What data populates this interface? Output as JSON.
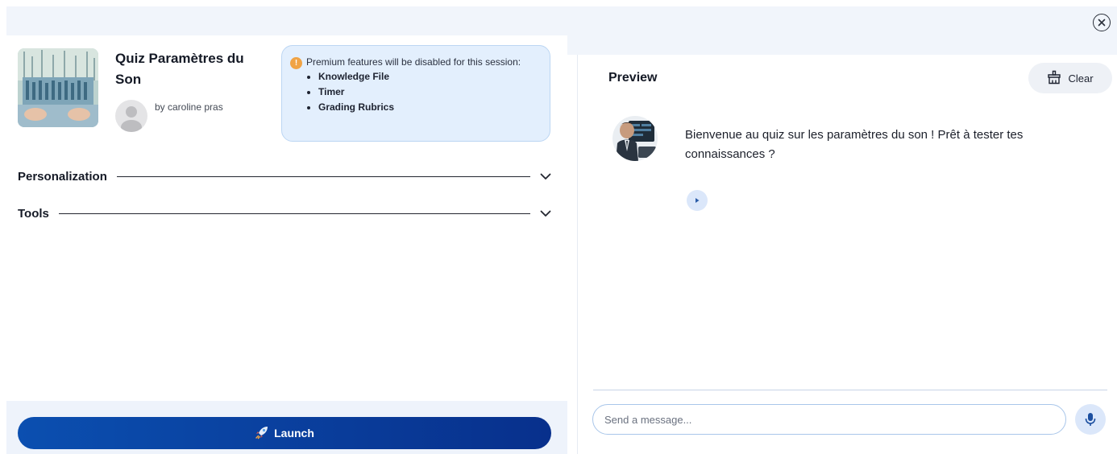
{
  "header": {
    "close_icon": "close-circle-icon"
  },
  "gpt": {
    "title": "Quiz Paramètres du Son",
    "author": "by caroline pras"
  },
  "premium": {
    "message": "Premium features will be disabled for this session:",
    "features": [
      "Knowledge File",
      "Timer",
      "Grading Rubrics"
    ]
  },
  "sections": [
    {
      "label": "Personalization"
    },
    {
      "label": "Tools"
    }
  ],
  "launch": {
    "label": "Launch",
    "icon": "rocket-icon"
  },
  "preview": {
    "title": "Preview",
    "clear_label": "Clear",
    "bot_message": "Bienvenue au quiz sur les paramètres du son ! Prêt à tester tes connaissances ?",
    "input_placeholder": "Send a message..."
  },
  "colors": {
    "accent": "#0b4fb0",
    "premium_bg": "#e3effd",
    "warn": "#f0a345"
  }
}
